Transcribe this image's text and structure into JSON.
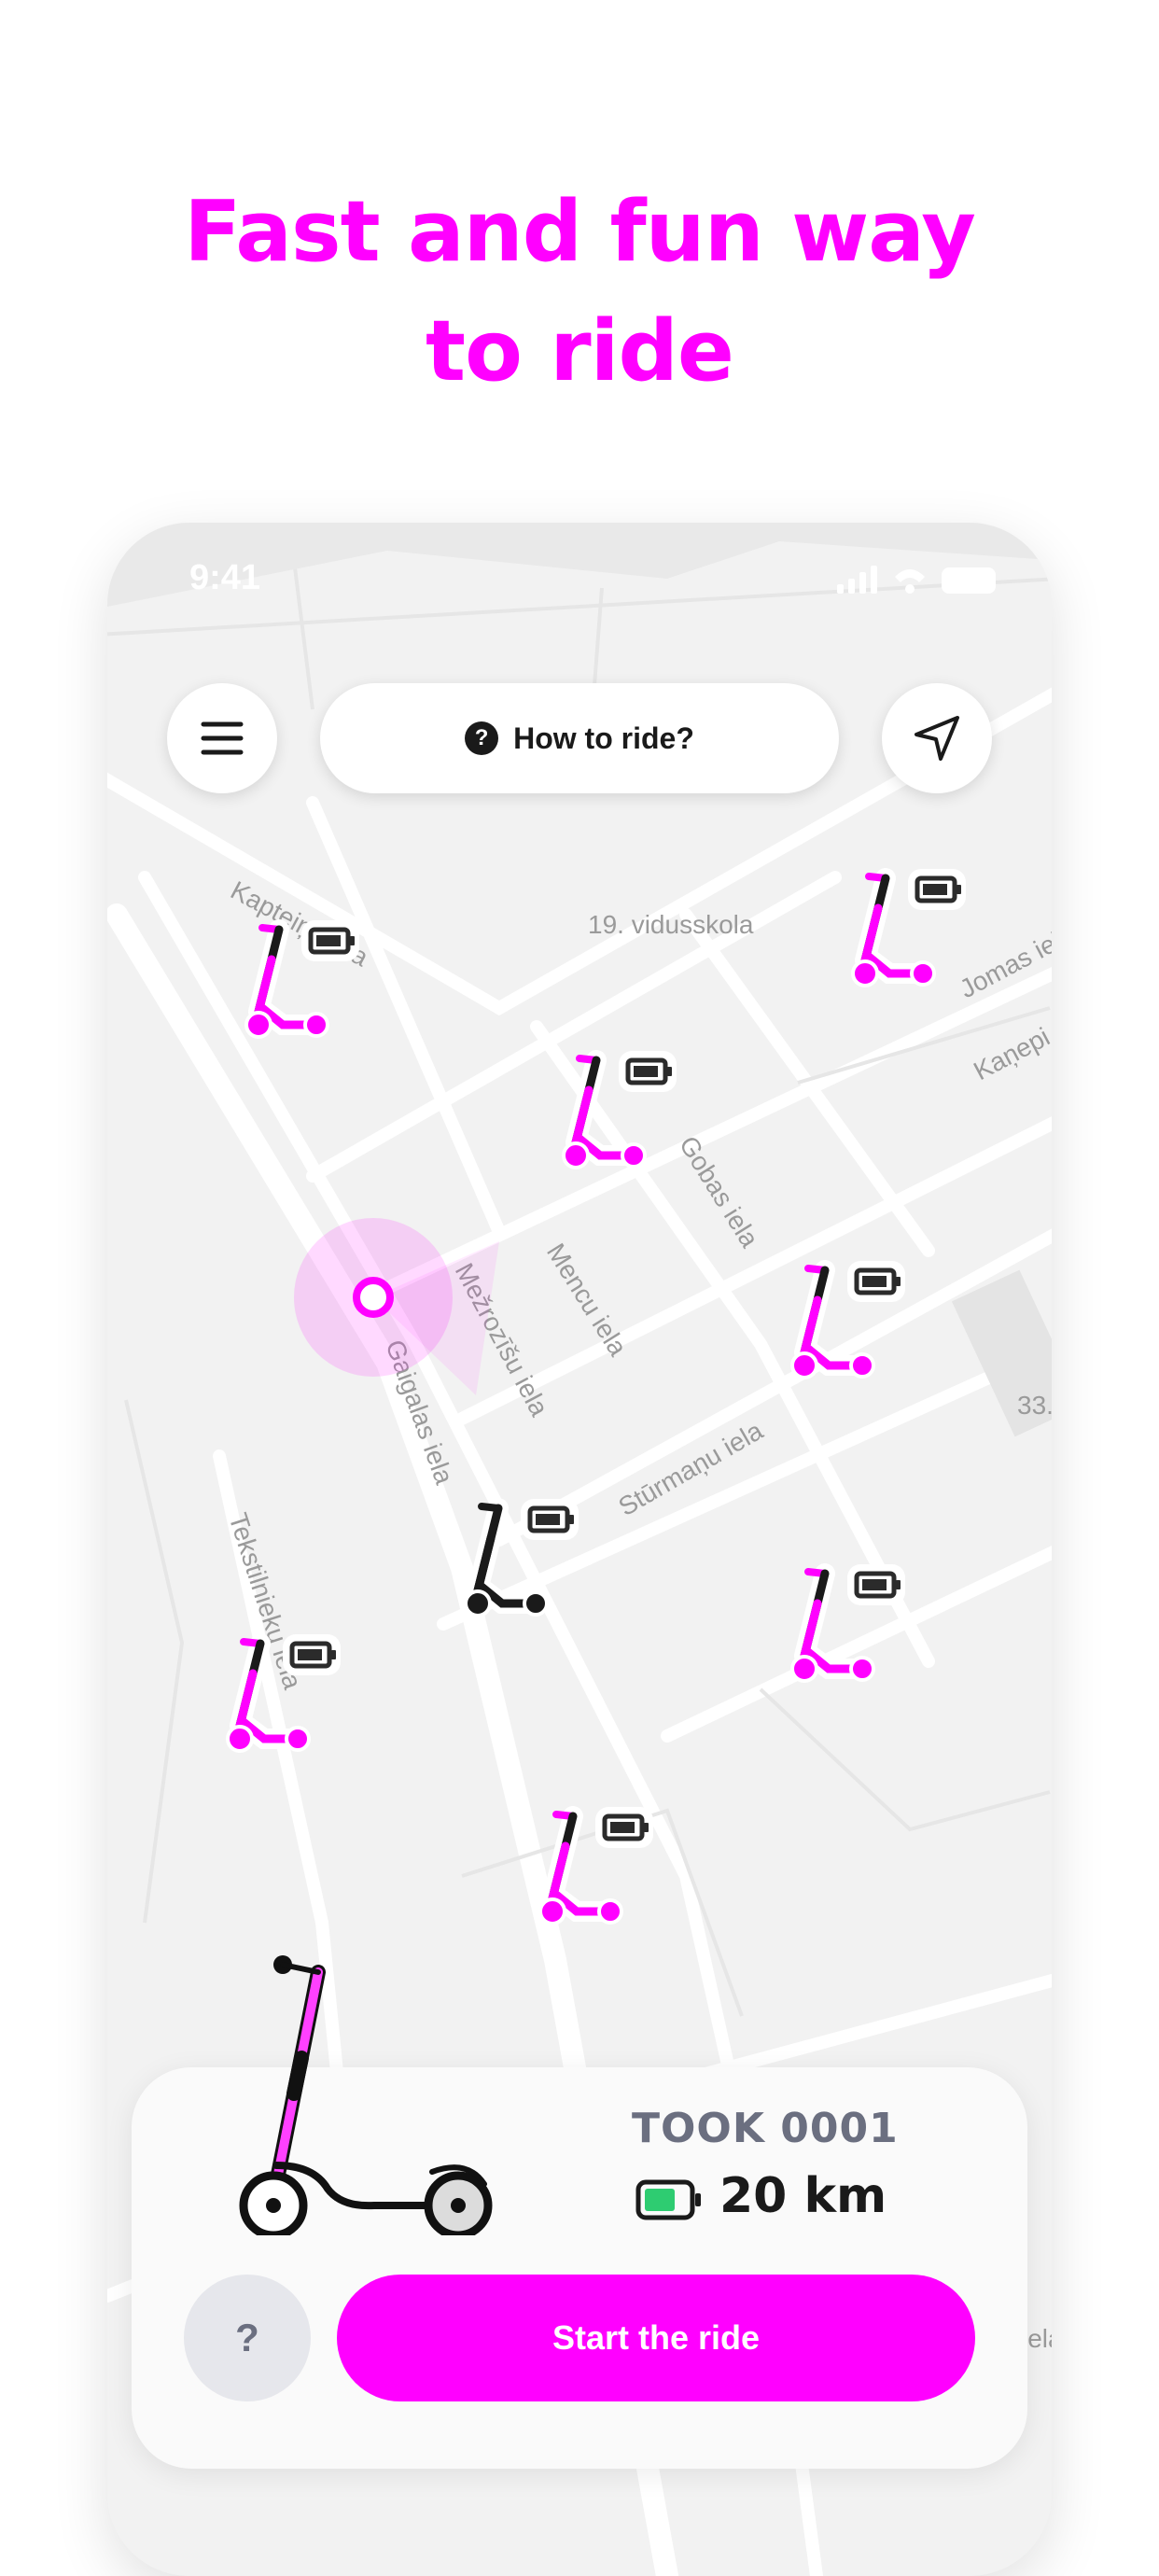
{
  "headline": {
    "line1": "Fast and fun way",
    "line2": "to ride"
  },
  "status_bar": {
    "time": "9:41"
  },
  "top_bar": {
    "how_to_label": "How to ride?",
    "help_glyph": "?"
  },
  "map": {
    "labels": {
      "school": "19. vidusskola",
      "kapteinu": "Kapteiņu iela",
      "jomas": "Jomas iela",
      "kanepi": "Kaņepi",
      "gobas": "Gobas iela",
      "mencu": "Mencu iela",
      "mezrozisu": "Mežrozīšu iela",
      "gaigalas": "Gaigalas iela",
      "sturmanu": "Stūrmaņu iela",
      "tekstilnieku": "Tekstilnieku iela",
      "num33": "33.",
      "iela_edge": "iela"
    }
  },
  "vehicle_card": {
    "id": "TOOK 0001",
    "range": "20 km",
    "help_label": "?",
    "start_label": "Start the ride"
  },
  "colors": {
    "brand": "#ff00ff",
    "text_dark": "#1a1a1a",
    "muted": "#6b6f80",
    "battery": "#2ecc71"
  }
}
